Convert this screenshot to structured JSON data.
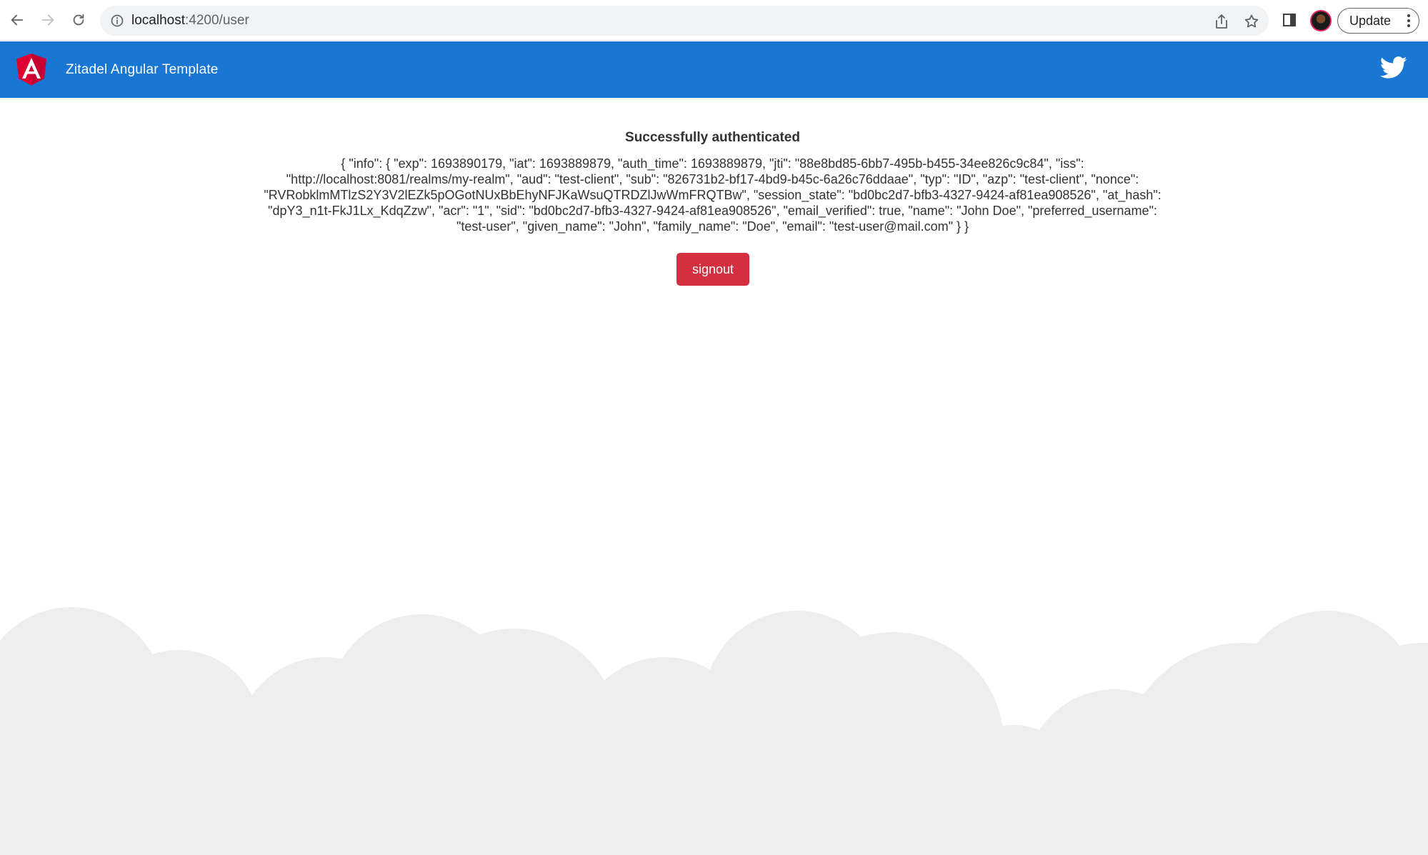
{
  "browser": {
    "url_host": "localhost",
    "url_path": ":4200/user",
    "update_label": "Update"
  },
  "header": {
    "title": "Zitadel Angular Template"
  },
  "main": {
    "heading": "Successfully authenticated",
    "json_text": "{ \"info\": { \"exp\": 1693890179, \"iat\": 1693889879, \"auth_time\": 1693889879, \"jti\": \"88e8bd85-6bb7-495b-b455-34ee826c9c84\", \"iss\": \"http://localhost:8081/realms/my-realm\", \"aud\": \"test-client\", \"sub\": \"826731b2-bf17-4bd9-b45c-6a26c76ddaae\", \"typ\": \"ID\", \"azp\": \"test-client\", \"nonce\": \"RVRobklmMTlzS2Y3V2lEZk5pOGotNUxBbEhyNFJKaWsuQTRDZlJwWmFRQTBw\", \"session_state\": \"bd0bc2d7-bfb3-4327-9424-af81ea908526\", \"at_hash\": \"dpY3_n1t-FkJ1Lx_KdqZzw\", \"acr\": \"1\", \"sid\": \"bd0bc2d7-bfb3-4327-9424-af81ea908526\", \"email_verified\": true, \"name\": \"John Doe\", \"preferred_username\": \"test-user\", \"given_name\": \"John\", \"family_name\": \"Doe\", \"email\": \"test-user@mail.com\" } }",
    "signout_label": "signout"
  },
  "colors": {
    "header_bg": "#1976d2",
    "signout_bg": "#d32f3f",
    "cloud": "#eeeeee"
  }
}
